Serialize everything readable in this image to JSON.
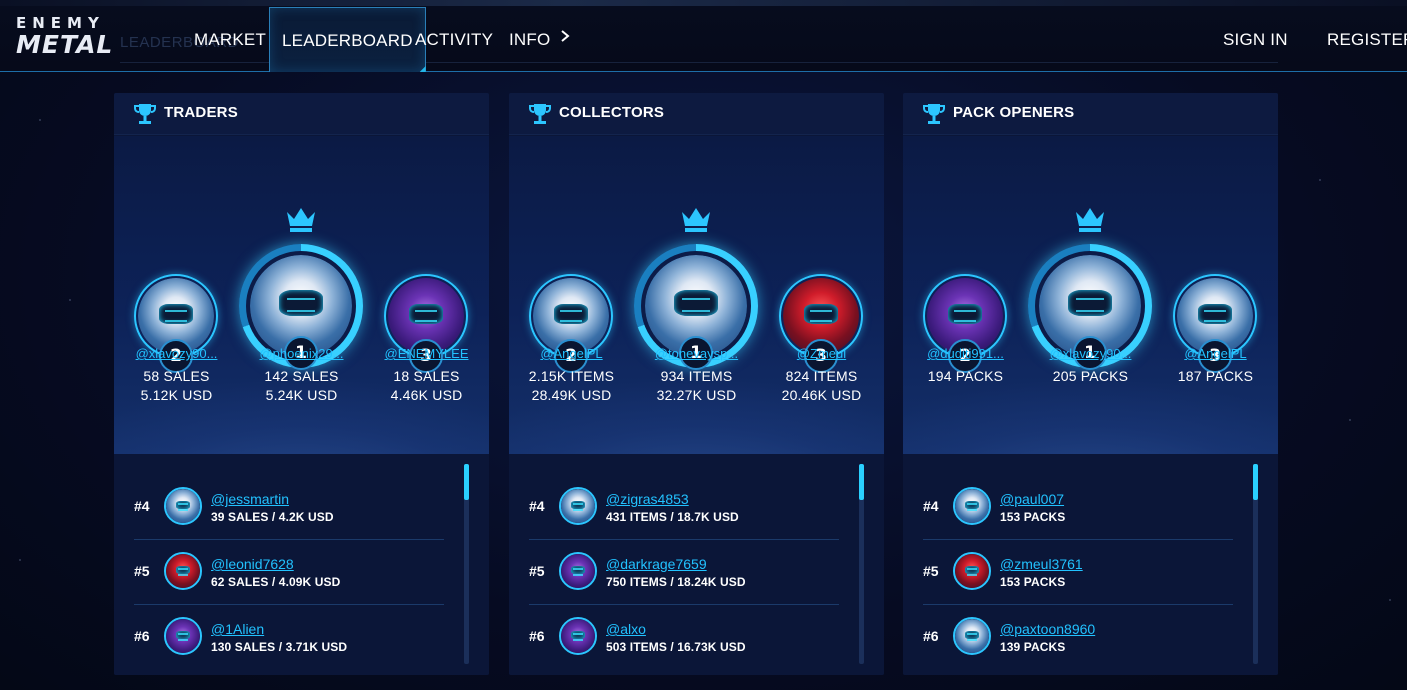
{
  "app": {
    "logo_top": "ENEMY",
    "logo_bottom": "METAL",
    "ghost_text": "LEADERBOARD"
  },
  "nav": {
    "items": [
      {
        "label": "MARKET"
      },
      {
        "label": "LEADERBOARD",
        "active": true
      },
      {
        "label": "ACTIVITY"
      },
      {
        "label": "INFO"
      }
    ],
    "sign_in": "SIGN IN",
    "register": "REGISTER"
  },
  "colors": {
    "accent": "#22c2ff",
    "panel": "#0b1638",
    "background": "#050a1c"
  },
  "panels": [
    {
      "title": "TRADERS",
      "podium": [
        {
          "rank": "2",
          "name": "@xlavozy90...",
          "stat1": "58 SALES",
          "stat2": "5.12K USD",
          "avatar": "white-robot"
        },
        {
          "rank": "1",
          "name": "@phoenix29...",
          "stat1": "142 SALES",
          "stat2": "5.24K USD",
          "avatar": "white-robot"
        },
        {
          "rank": "3",
          "name": "@ENEMYLEE",
          "stat1": "18 SALES",
          "stat2": "4.46K USD",
          "avatar": "purple-robot"
        }
      ],
      "list": [
        {
          "rank": "#4",
          "name": "@jessmartin",
          "stat": "39 SALES / 4.2K USD",
          "avatar": "white-robot"
        },
        {
          "rank": "#5",
          "name": "@leonid7628",
          "stat": "62 SALES / 4.09K USD",
          "avatar": "red-robot"
        },
        {
          "rank": "#6",
          "name": "@1Alien",
          "stat": "130 SALES / 3.71K USD",
          "avatar": "purple-robot"
        }
      ]
    },
    {
      "title": "COLLECTORS",
      "podium": [
        {
          "rank": "2",
          "name": "@AngelPL",
          "stat1": "2.15K ITEMS",
          "stat2": "28.49K USD",
          "avatar": "white-robot"
        },
        {
          "rank": "1",
          "name": "@tonevaysp...",
          "stat1": "934 ITEMS",
          "stat2": "32.27K USD",
          "avatar": "white-robot"
        },
        {
          "rank": "3",
          "name": "@Zmeul",
          "stat1": "824 ITEMS",
          "stat2": "20.46K USD",
          "avatar": "red-robot"
        }
      ],
      "list": [
        {
          "rank": "#4",
          "name": "@zigras4853",
          "stat": "431 ITEMS / 18.7K USD",
          "avatar": "white-robot"
        },
        {
          "rank": "#5",
          "name": "@darkrage7659",
          "stat": "750 ITEMS / 18.24K USD",
          "avatar": "purple-robot"
        },
        {
          "rank": "#6",
          "name": "@alxo",
          "stat": "503 ITEMS / 16.73K USD",
          "avatar": "purple-robot"
        }
      ]
    },
    {
      "title": "PACK OPENERS",
      "podium": [
        {
          "rank": "2",
          "name": "@duditi991...",
          "stat1": "194 PACKS",
          "stat2": "",
          "avatar": "purple-robot"
        },
        {
          "rank": "1",
          "name": "@xlavozy90...",
          "stat1": "205 PACKS",
          "stat2": "",
          "avatar": "white-robot"
        },
        {
          "rank": "3",
          "name": "@AngelPL",
          "stat1": "187 PACKS",
          "stat2": "",
          "avatar": "white-robot"
        }
      ],
      "list": [
        {
          "rank": "#4",
          "name": "@paul007",
          "stat": "153 PACKS",
          "avatar": "white-robot"
        },
        {
          "rank": "#5",
          "name": "@zmeul3761",
          "stat": "153 PACKS",
          "avatar": "red-robot"
        },
        {
          "rank": "#6",
          "name": "@paxtoon8960",
          "stat": "139 PACKS",
          "avatar": "white-robot"
        }
      ]
    }
  ]
}
